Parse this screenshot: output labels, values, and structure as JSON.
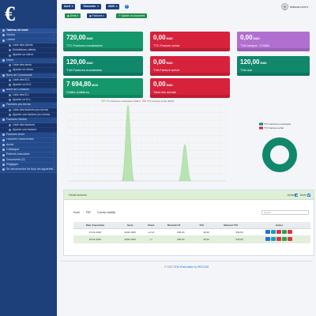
{
  "sidebar": {
    "logo_text": "€",
    "items": [
      {
        "label": "Tableau de bord",
        "kind": "active"
      },
      {
        "label": "Ventes",
        "kind": "section"
      },
      {
        "label": "Clients",
        "kind": "section"
      },
      {
        "label": "Liste des clients",
        "kind": "sub"
      },
      {
        "label": "Emballeurs clients",
        "kind": "sub"
      },
      {
        "label": "Ajouter un client",
        "kind": "sub"
      },
      {
        "label": "Devis",
        "kind": "section"
      },
      {
        "label": "Liste des devis",
        "kind": "sub"
      },
      {
        "label": "Ajouter un devis",
        "kind": "sub"
      },
      {
        "label": "Bons de Commande",
        "kind": "section"
      },
      {
        "label": "Liste des B.C.",
        "kind": "sub"
      },
      {
        "label": "Ajouter un B.C.",
        "kind": "sub"
      },
      {
        "label": "Bons de Livraison",
        "kind": "section"
      },
      {
        "label": "Liste des B.L.",
        "kind": "sub"
      },
      {
        "label": "Ajouter un B.L.",
        "kind": "sub"
      },
      {
        "label": "Factures pro-forma",
        "kind": "section"
      },
      {
        "label": "Liste des factures pro-forma",
        "kind": "sub"
      },
      {
        "label": "Ajouter une facture pro-forma",
        "kind": "sub"
      },
      {
        "label": "Factures Ventes",
        "kind": "section"
      },
      {
        "label": "Liste des factures",
        "kind": "sub"
      },
      {
        "label": "Ajouter une facture",
        "kind": "sub"
      },
      {
        "label": "Factures Avoir",
        "kind": "section"
      },
      {
        "label": "Factures Récurrentes",
        "kind": "section"
      },
      {
        "label": "Achat",
        "kind": "section"
      },
      {
        "label": "Catalogue",
        "kind": "section"
      },
      {
        "label": "Relevés bancaires",
        "kind": "section"
      },
      {
        "label": "Documents (0)",
        "kind": "section"
      },
      {
        "label": "Réglages",
        "kind": "section"
      },
      {
        "label": "Se déconnecter de tous les appareils",
        "kind": "section"
      }
    ]
  },
  "topbar": {
    "month": "Avril",
    "quarter": "Trimestre",
    "year": "2020",
    "help": "?",
    "username": "redouan.sml",
    "devis_btn": "Devis",
    "factures_btn": "Factures",
    "add_doc_btn": "Ajouter un document"
  },
  "cards": [
    {
      "value": "720,00",
      "unit": "MAD",
      "label": "TTC Factures encaissées",
      "color": "green"
    },
    {
      "value": "0,00",
      "unit": "MAD",
      "label": "TTC Facture achat",
      "color": "red"
    },
    {
      "value": "0,00",
      "unit": "MAD",
      "label": "TVA banque : 0,00",
      "label2": "TVA banque : 0 MAD",
      "color": "purple"
    },
    {
      "value": "120,00",
      "unit": "MAD",
      "label": "TVA Factures encaissées",
      "color": "teal"
    },
    {
      "value": "0,00",
      "unit": "MAD",
      "label": "TVA Facture achat",
      "color": "red"
    },
    {
      "value": "120,00",
      "unit": "MAD",
      "label": "TVA due",
      "color": "teal"
    },
    {
      "value": "7 694,80",
      "unit": "MAD",
      "label": "Chiffre d'affaires",
      "color": "green"
    },
    {
      "value": "0,00",
      "unit": "MAD",
      "label": "Total des achats",
      "color": "red"
    }
  ],
  "chart_data": [
    {
      "type": "area",
      "series": [
        {
          "name": "TTC Factures encaissées (MAD)",
          "color": "#b7e4b0"
        },
        {
          "name": "TTC Facture achat (MAD)",
          "color": "#f4b6c2"
        }
      ],
      "peaks": [
        {
          "position_fraction": 0.38,
          "height_fraction": 1.0
        },
        {
          "position_fraction": 0.74,
          "height_fraction": 0.48
        }
      ]
    },
    {
      "type": "pie",
      "series": [
        {
          "name": "TTC Factures encaissées",
          "value": 100,
          "color": "#11876b"
        },
        {
          "name": "TTC Facture achat",
          "value": 0,
          "color": "#d7223c"
        }
      ]
    }
  ],
  "table": {
    "title": "Détail factures",
    "filter_achat": "Achat",
    "filter_vente": "Vente",
    "tools": [
      "Excel",
      "PDF",
      "Column visibility"
    ],
    "search_placeholder": "Search:",
    "columns": [
      "Date d'opération",
      "Serie",
      "Client",
      "Montant HT",
      "TVA",
      "Montant TTC",
      "Action"
    ],
    "rows": [
      {
        "date": "07-04-2020",
        "serie": "2002-2025",
        "client": "exhall",
        "ht": "600,00",
        "tva": "90,00",
        "ttc": "690,00"
      },
      {
        "date": "18-04-2020",
        "serie": "2002-2025",
        "client": "mi",
        "ht": "200,00",
        "tva": "40,00",
        "ttc": "240,00"
      }
    ]
  },
  "footer": {
    "prefix": "© 2020 ",
    "brand": "OTM eFacturation",
    "middle": " by ",
    "company": "SEDCOM"
  }
}
